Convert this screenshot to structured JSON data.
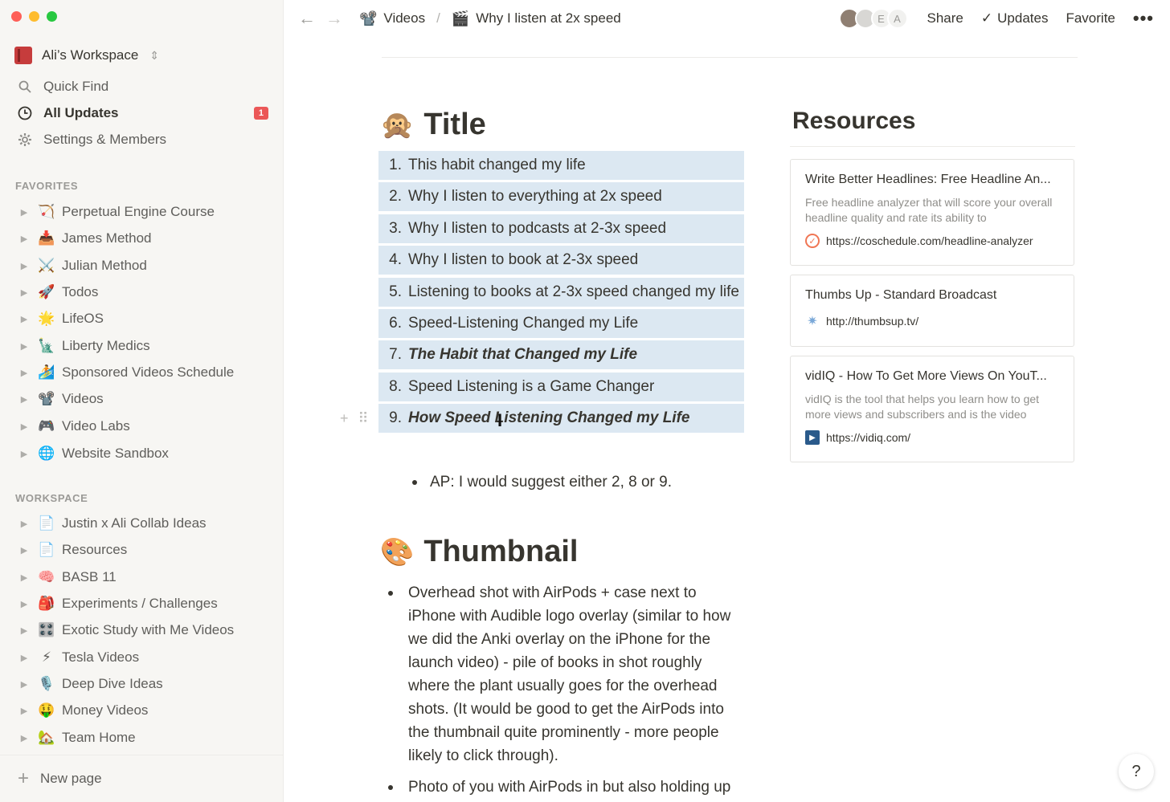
{
  "sidebar": {
    "workspace_name": "Ali’s Workspace",
    "quick_find": "Quick Find",
    "all_updates": "All Updates",
    "updates_badge": "1",
    "settings": "Settings & Members",
    "favorites_label": "FAVORITES",
    "favorites": [
      {
        "emoji": "🏹",
        "label": "Perpetual Engine Course"
      },
      {
        "emoji": "📥",
        "label": "James Method"
      },
      {
        "emoji": "⚔️",
        "label": "Julian Method"
      },
      {
        "emoji": "🚀",
        "label": "Todos"
      },
      {
        "emoji": "🌟",
        "label": "LifeOS"
      },
      {
        "emoji": "🗽",
        "label": "Liberty Medics"
      },
      {
        "emoji": "🏄",
        "label": "Sponsored Videos Schedule"
      },
      {
        "emoji": "📽️",
        "label": "Videos"
      },
      {
        "emoji": "🎮",
        "label": "Video Labs"
      },
      {
        "emoji": "🌐",
        "label": "Website Sandbox"
      }
    ],
    "workspace_label": "WORKSPACE",
    "workspace_items": [
      {
        "emoji": "📄",
        "label": "Justin x Ali Collab Ideas"
      },
      {
        "emoji": "📄",
        "label": "Resources"
      },
      {
        "emoji": "🧠",
        "label": "BASB 11"
      },
      {
        "emoji": "🎒",
        "label": "Experiments / Challenges"
      },
      {
        "emoji": "🎛️",
        "label": "Exotic Study with Me Videos"
      },
      {
        "emoji": "⚡",
        "label": "Tesla Videos"
      },
      {
        "emoji": "🎙️",
        "label": "Deep Dive Ideas"
      },
      {
        "emoji": "🤑",
        "label": "Money Videos"
      },
      {
        "emoji": "🏡",
        "label": "Team Home"
      }
    ],
    "new_page": "New page"
  },
  "topbar": {
    "crumb_parent_emoji": "📽️",
    "crumb_parent": "Videos",
    "crumb_sep": "/",
    "crumb_current_emoji": "🎬",
    "crumb_current": "Why I listen at 2x speed",
    "avatar_e": "E",
    "avatar_a": "A",
    "share": "Share",
    "updates": "Updates",
    "favorite": "Favorite",
    "more": "•••"
  },
  "content": {
    "title_emoji": "🙊",
    "title_heading": "Title",
    "title_options": [
      {
        "num": "1.",
        "text": "This habit changed my life",
        "emphasis": false
      },
      {
        "num": "2.",
        "text": "Why I listen to everything at 2x speed",
        "emphasis": false
      },
      {
        "num": "3.",
        "text": "Why I listen to podcasts at 2-3x speed",
        "emphasis": false
      },
      {
        "num": "4.",
        "text": "Why I listen to book at 2-3x speed",
        "emphasis": false
      },
      {
        "num": "5.",
        "text": "Listening to books at 2-3x speed changed my life",
        "emphasis": false
      },
      {
        "num": "6.",
        "text": "Speed-Listening Changed my Life",
        "emphasis": false
      },
      {
        "num": "7.",
        "text": "The Habit that Changed my Life",
        "emphasis": true
      },
      {
        "num": "8.",
        "text": "Speed Listening is a Game Changer",
        "emphasis": false
      },
      {
        "num": "9.",
        "text": "How Speed Listening Changed my Life",
        "emphasis": true
      }
    ],
    "ap_note": "AP: I would suggest either 2, 8 or 9.",
    "thumbnail_emoji": "🎨",
    "thumbnail_heading": "Thumbnail",
    "thumbnail_bullets": [
      "Overhead shot with AirPods + case next to iPhone with Audible logo overlay (similar to how we did the Anki overlay on the iPhone for the launch video) - pile of books in shot roughly where the plant usually goes for the overhead shots. (It would be good to get the AirPods into the thumbnail quite prominently - more people likely to click through).",
      "Photo of you with AirPods in but also holding up"
    ]
  },
  "resources": {
    "heading": "Resources",
    "cards": [
      {
        "title": "Write Better Headlines: Free Headline An...",
        "desc": "Free headline analyzer that will score your overall headline quality and rate its ability to",
        "url": "https://coschedule.com/headline-analyzer"
      },
      {
        "title": "Thumbs Up - Standard Broadcast",
        "desc": "",
        "url": "http://thumbsup.tv/"
      },
      {
        "title": "vidIQ - How To Get More Views On YouT...",
        "desc": "vidIQ is the tool that helps you learn how to get more views and subscribers and is the video",
        "url": "https://vidiq.com/"
      }
    ]
  },
  "help_label": "?"
}
